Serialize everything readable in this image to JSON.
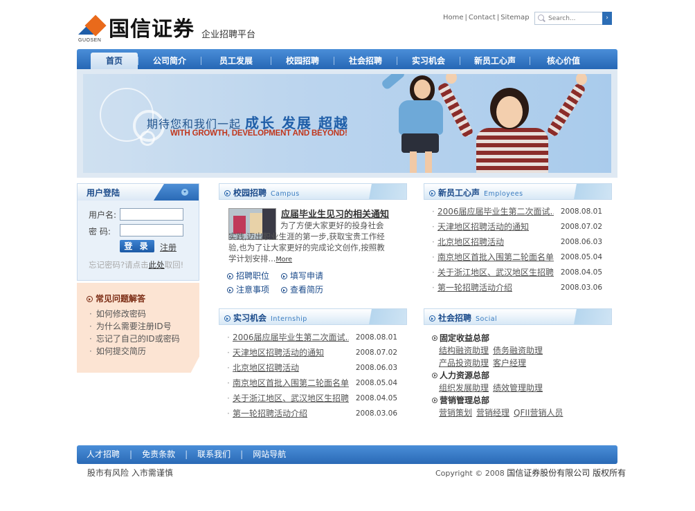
{
  "header": {
    "logo_en": "GUOSEN",
    "logo_name": "国信证券",
    "logo_sub": "企业招聘平台",
    "links": [
      "Home",
      "Contact",
      "Sitemap"
    ],
    "search_placeholder": "Search..."
  },
  "nav": [
    "首页",
    "公司简介",
    "员工发展",
    "校园招聘",
    "社会招聘",
    "实习机会",
    "新员工心声",
    "核心价值"
  ],
  "banner": {
    "cn": "期待您和我们一起",
    "cn_big": "成长  发展  超越",
    "en": "WITH GROWTH, DEVELOPMENT AND BEYOND!"
  },
  "login": {
    "title": "用户登陆",
    "username_label": "用户名:",
    "password_label": "密   码:",
    "login_button": "登 录",
    "register_link": "注册",
    "forgot_pre": "忘记密码?请点击",
    "forgot_link": "此处",
    "forgot_post": "取回!"
  },
  "faq": {
    "title": "常见问题解答",
    "items": [
      "如何修改密码",
      "为什么需要注册ID号",
      "忘记了自己的ID或密码",
      "如何提交简历"
    ]
  },
  "campus": {
    "title": "校园招聘",
    "title_en": "Campus",
    "article_title": "应届毕业生见习的相关通知",
    "article_text": "为了方便大家更好的投身社会实践,迈出职业生涯的第一步,获取宝贵工作经验,也为了让大家更好的完成论文创作,按照教学计划安排...",
    "more": "More",
    "quick_links": [
      "招聘职位",
      "填写申请",
      "注意事项",
      "查看简历"
    ]
  },
  "employees": {
    "title": "新员工心声",
    "title_en": "Employees",
    "items": [
      {
        "title": "2006届应届毕业生第二次面试...",
        "date": "2008.08.01"
      },
      {
        "title": "天津地区招聘活动的通知",
        "date": "2008.07.02"
      },
      {
        "title": "北京地区招聘活动",
        "date": "2008.06.03"
      },
      {
        "title": "南京地区首批入围第二轮面名单",
        "date": "2008.05.04"
      },
      {
        "title": "关于浙江地区、武汉地区生招聘...",
        "date": "2008.04.05"
      },
      {
        "title": "第一轮招聘活动介绍",
        "date": "2008.03.06"
      }
    ]
  },
  "internship": {
    "title": "实习机会",
    "title_en": "Internship",
    "items": [
      {
        "title": "2006届应届毕业生第二次面试...",
        "date": "2008.08.01"
      },
      {
        "title": "天津地区招聘活动的通知",
        "date": "2008.07.02"
      },
      {
        "title": "北京地区招聘活动",
        "date": "2008.06.03"
      },
      {
        "title": "南京地区首批入围第二轮面名单",
        "date": "2008.05.04"
      },
      {
        "title": "关于浙江地区、武汉地区生招聘...",
        "date": "2008.04.05"
      },
      {
        "title": "第一轮招聘活动介绍",
        "date": "2008.03.06"
      }
    ]
  },
  "social": {
    "title": "社会招聘",
    "title_en": "Social",
    "groups": [
      {
        "name": "固定收益总部",
        "rows": [
          [
            "结构融资助理",
            "债务融资助理"
          ],
          [
            "产品投资助理",
            "客户经理"
          ]
        ]
      },
      {
        "name": "人力资源总部",
        "rows": [
          [
            "组织发展助理",
            "绩效管理助理"
          ]
        ]
      },
      {
        "name": "营销管理总部",
        "rows": [
          [
            "营销策划",
            "营销经理",
            "QFII营销人员"
          ]
        ]
      }
    ]
  },
  "footer": {
    "links": [
      "人才招聘",
      "免责条款",
      "联系我们",
      "网站导航"
    ],
    "risk": "股市有风险  入市需谨慎",
    "copyright_pre": "Copyright © 2008",
    "copyright_cn": "国信证券股份有限公司 版权所有"
  },
  "colors": {
    "primary": "#2667b5",
    "accent": "#e96a1b",
    "faq_bg": "#fce4d3"
  }
}
